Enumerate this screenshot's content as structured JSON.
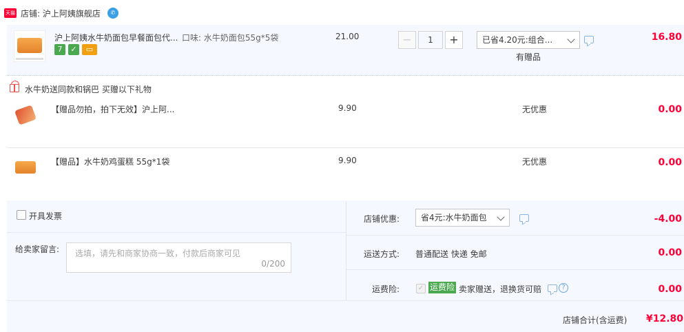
{
  "shop": {
    "badge": "天猫",
    "label": "店铺: 沪上阿姨旗舰店",
    "ww_icon": "ww-chat-icon"
  },
  "main_item": {
    "title": "沪上阿姨水牛奶面包早餐面包代...",
    "sku": "口味: 水牛奶面包55g*5袋",
    "price": "21.00",
    "quantity": "1",
    "minus": "−",
    "plus": "+",
    "promo_select": "已省4.20元:组合...",
    "gift_note": "有赠品",
    "subtotal": "16.80",
    "service_badges": [
      {
        "icon": "seven-day-return-icon",
        "text": "7",
        "color": "#4aa84e"
      },
      {
        "icon": "quality-guarantee-icon",
        "text": "✓",
        "color": "#4aa84e"
      },
      {
        "icon": "card-pay-icon",
        "text": "▭",
        "color": "#f0a010"
      }
    ]
  },
  "gift_section": {
    "title": "水牛奶送同款和锅巴   买赠以下礼物",
    "items": [
      {
        "title": "【赠品勿拍，拍下无效】沪上阿...",
        "price": "9.90",
        "promo": "无优惠",
        "subtotal": "0.00"
      },
      {
        "title": "【赠品】水牛奶鸡蛋糕 55g*1袋",
        "price": "9.90",
        "promo": "无优惠",
        "subtotal": "0.00"
      }
    ]
  },
  "footer": {
    "invoice_label": "开具发票",
    "message_label": "给卖家留言:",
    "message_placeholder": "选填，请先和商家协商一致，付款后商家可见",
    "message_count": "0/200",
    "shop_discount_label": "店铺优惠:",
    "shop_discount_select": "省4元:水牛奶面包",
    "shop_discount_amount": "-4.00",
    "shipping_label": "运送方式:",
    "shipping_value": "普通配送 快递 免邮",
    "shipping_amount": "0.00",
    "insurance_label": "运费险:",
    "insurance_tag": "运费险",
    "insurance_text": "卖家赠送，退换货可赔",
    "insurance_amount": "0.00",
    "total_label": "店铺合计(含运费)",
    "total_amount": "¥12.80"
  },
  "colors": {
    "accent_red": "#ff0036",
    "row_bg": "#f5f9ff",
    "green": "#4aa84e"
  }
}
